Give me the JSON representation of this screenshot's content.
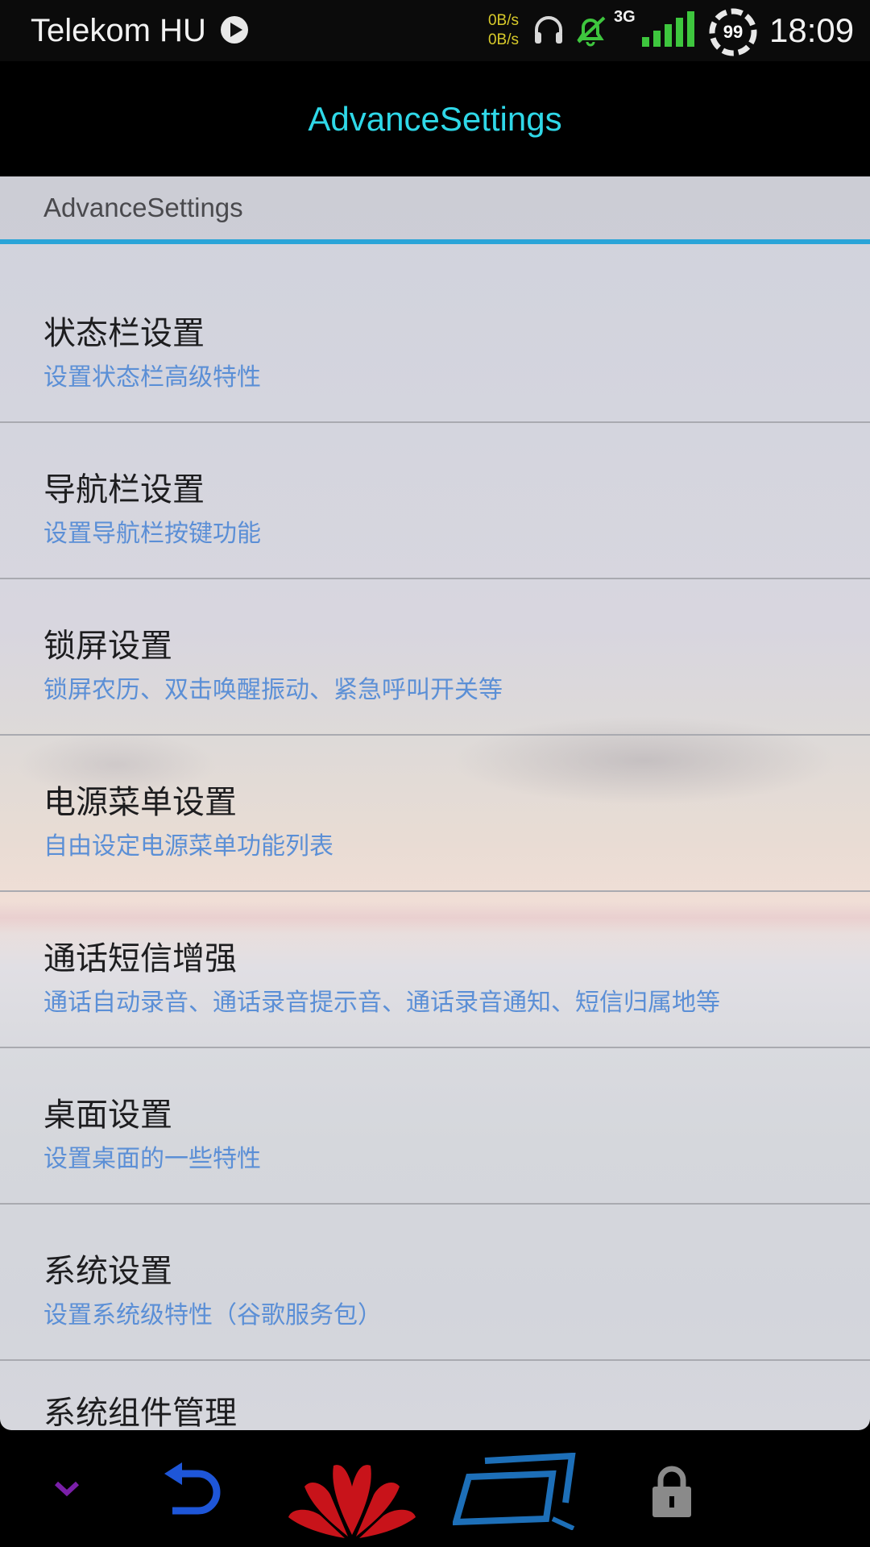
{
  "status_bar": {
    "carrier": "Telekom HU",
    "speed_up": "0B/s",
    "speed_down": "0B/s",
    "network_type": "3G",
    "battery_level": "99",
    "time": "18:09",
    "icons": [
      "play-icon",
      "headset-icon",
      "alarm-off-icon",
      "signal-icon",
      "battery-icon"
    ]
  },
  "app_bar": {
    "title": "AdvanceSettings"
  },
  "section": {
    "title": "AdvanceSettings"
  },
  "items": [
    {
      "title": "状态栏设置",
      "summary": "设置状态栏高级特性"
    },
    {
      "title": "导航栏设置",
      "summary": "设置导航栏按键功能"
    },
    {
      "title": "锁屏设置",
      "summary": "锁屏农历、双击唤醒振动、紧急呼叫开关等"
    },
    {
      "title": "电源菜单设置",
      "summary": "自由设定电源菜单功能列表"
    },
    {
      "title": "通话短信增强",
      "summary": "通话自动录音、通话录音提示音、通话录音通知、短信归属地等"
    },
    {
      "title": "桌面设置",
      "summary": "设置桌面的一些特性"
    },
    {
      "title": "系统设置",
      "summary": "设置系统级特性（谷歌服务包）"
    },
    {
      "title": "系统组件管理",
      "summary": ""
    }
  ],
  "navbar": {
    "buttons": [
      "hide-navbar-icon",
      "back-icon",
      "home-huawei-logo-icon",
      "recent-apps-icon",
      "lock-screen-icon"
    ],
    "colors": {
      "hide": "#7a1fa8",
      "back": "#1e56d8",
      "home": "#c8131a",
      "recent": "#1d6fb8",
      "lock": "#8a8a8a"
    }
  }
}
